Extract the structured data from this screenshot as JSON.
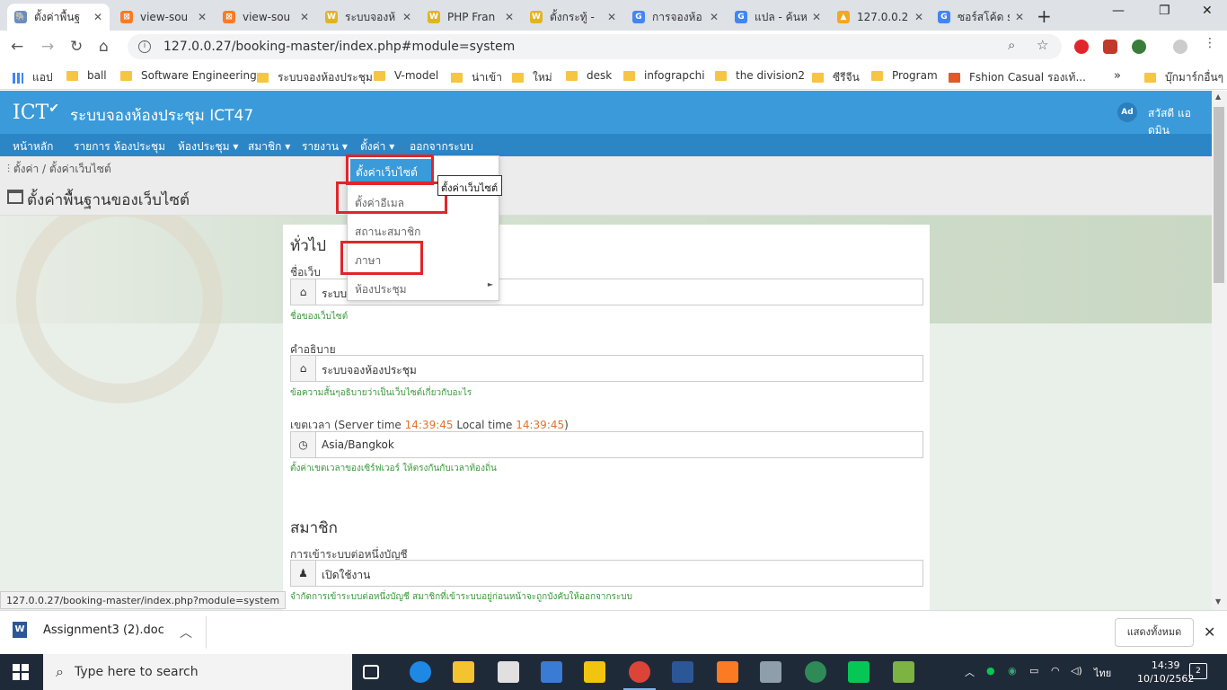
{
  "browser": {
    "tabs": [
      {
        "label": "ตั้งค่าพื้นฐ",
        "icon": "elephant-icon",
        "color": "#6a8dbd"
      },
      {
        "label": "view-sou",
        "icon": "xampp-icon",
        "color": "#fb7a24"
      },
      {
        "label": "view-sou",
        "icon": "xampp-icon",
        "color": "#fb7a24"
      },
      {
        "label": "ระบบจองห้",
        "icon": "wsr-icon",
        "color": "#e0b520"
      },
      {
        "label": "PHP Fran",
        "icon": "wsr-icon",
        "color": "#e0b520"
      },
      {
        "label": "ตั้งกระทู้ - ",
        "icon": "wsr-icon",
        "color": "#e0b520"
      },
      {
        "label": "การจองห้อ",
        "icon": "google-icon",
        "color": "#4285f4"
      },
      {
        "label": "แปล - ค้นห",
        "icon": "google-icon",
        "color": "#4285f4"
      },
      {
        "label": "127.0.0.2",
        "icon": "pma-icon",
        "color": "#f5a623"
      },
      {
        "label": "ซอร์สโค้ด s",
        "icon": "google-icon",
        "color": "#4285f4"
      }
    ],
    "url": "127.0.0.27/booking-master/index.php#module=system",
    "bookmarks": [
      "แอป",
      "ball",
      "Software Engineering",
      "ระบบจองห้องประชุม",
      "V-model",
      "น่าเข้า",
      "ใหม่",
      "desk",
      "infograpchi",
      "the division2",
      "ซีรีจีน",
      "Program",
      "Fshion Casual รองเท้...",
      "บุ๊กมาร์กอื่นๆ"
    ],
    "bookmark_more": "»",
    "status_url": "127.0.0.27/booking-master/index.php?module=system"
  },
  "site": {
    "logo": "ICT",
    "title": "ระบบจองห้องประชุม ICT47",
    "user_initials": "Ad",
    "user_name": "สวัสดี แอดมิน",
    "nav": [
      "หน้าหลัก",
      "รายการ ห้องประชุม",
      "ห้องประชุม ▾",
      "สมาชิก ▾",
      "รายงาน ▾",
      "ตั้งค่า ▾",
      "ออกจากระบบ"
    ],
    "breadcrumb": "ตั้งค่า / ตั้งค่าเว็บไซต์",
    "page_title": "ตั้งค่าพื้นฐานของเว็บไซต์"
  },
  "dropdown": {
    "items": [
      "ตั้งค่าเว็บไซต์",
      "ตั้งค่าอีเมล",
      "สถานะสมาชิก",
      "ภาษา",
      "ห้องประชุม"
    ],
    "submenu_arrow": "►",
    "tooltip": "ตั้งค่าเว็บไซต์"
  },
  "form": {
    "general_heading": "ทั่วไป",
    "site_name_label": "ชื่อเว็บ",
    "site_name_value": "ระบบจ",
    "site_name_hint": "ชื่อของเว็บไซต์",
    "desc_label": "คำอธิบาย",
    "desc_value": "ระบบจองห้องประชุม",
    "desc_hint": "ข้อความสั้นๆอธิบายว่าเป็นเว็บไซต์เกี่ยวกับอะไร",
    "tz_label_pre": "เขตเวลา (Server time ",
    "server_time": "14:39:45",
    "tz_label_mid": " Local time ",
    "local_time": "14:39:45",
    "tz_label_post": ")",
    "tz_value": "Asia/Bangkok",
    "tz_hint": "ตั้งค่าเขตเวลาของเซิร์ฟเวอร์ ให้ตรงกันกับเวลาท้องถิ่น",
    "member_heading": "สมาชิก",
    "login_label": "การเข้าระบบต่อหนึ่งบัญชี",
    "login_value": "เปิดใช้งาน",
    "login_hint": "จำกัดการเข้าระบบต่อหนึ่งบัญชี สมาชิกที่เข้าระบบอยู่ก่อนหน้าจะถูกบังคับให้ออกจากระบบ"
  },
  "download": {
    "file": "Assignment3 (2).doc",
    "show_all": "แสดงทั้งหมด"
  },
  "taskbar": {
    "search": "Type here to search",
    "lang": "ไทย",
    "time": "14:39",
    "date": "10/10/2562",
    "notifications": "2"
  },
  "colors": {
    "header": "#3b9ad9",
    "nav": "#2c86c6",
    "highlight": "#e0262b"
  }
}
